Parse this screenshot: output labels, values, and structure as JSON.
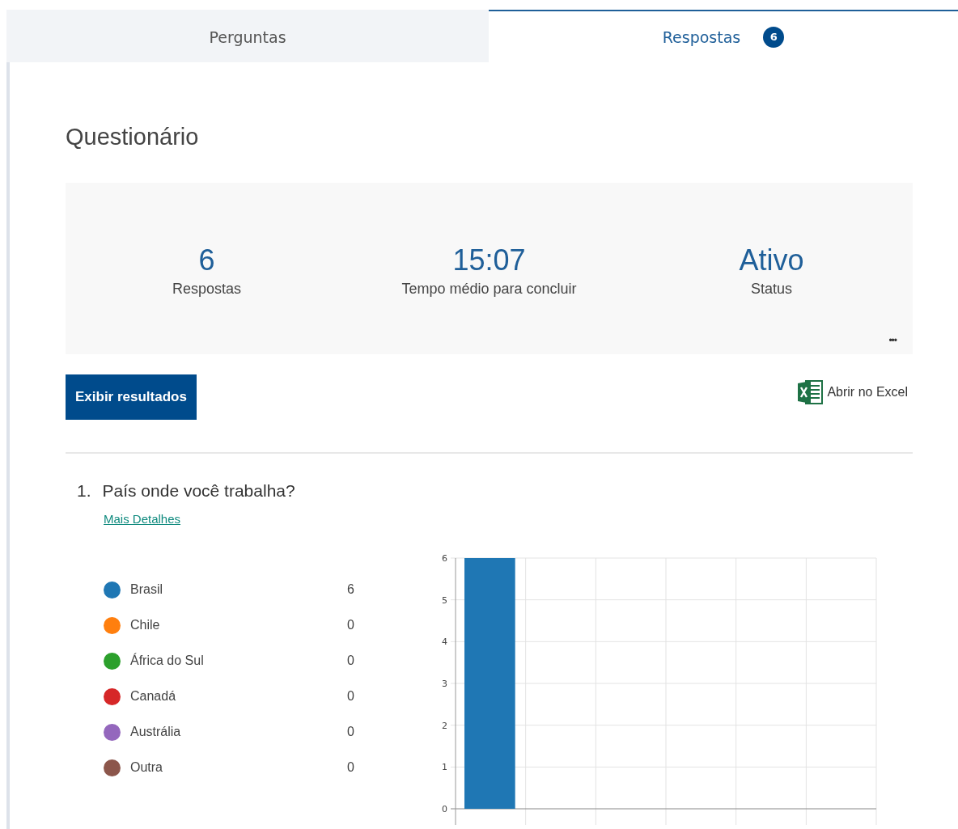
{
  "tabs": [
    {
      "label": "Perguntas",
      "selected": false
    },
    {
      "label": "Respostas",
      "selected": true,
      "badge": "6"
    }
  ],
  "title": "Questionário",
  "stats": [
    {
      "value": "6",
      "label": "Respostas"
    },
    {
      "value": "15:07",
      "label": "Tempo médio para concluir"
    },
    {
      "value": "Ativo",
      "label": "Status"
    }
  ],
  "more_button": "•••",
  "view_results_button": "Exibir resultados",
  "excel_link": "Abrir no Excel",
  "question": {
    "number": "1.",
    "text": "País onde você trabalha?",
    "details_link": "Mais Detalhes",
    "options": [
      {
        "label": "Brasil",
        "count": "6",
        "color": "#1f77b4"
      },
      {
        "label": "Chile",
        "count": "0",
        "color": "#ff7f0e"
      },
      {
        "label": "África do Sul",
        "count": "0",
        "color": "#2ca02c"
      },
      {
        "label": "Canadá",
        "count": "0",
        "color": "#d62728"
      },
      {
        "label": "Austrália",
        "count": "0",
        "color": "#9467bd"
      },
      {
        "label": "Outra",
        "count": "0",
        "color": "#8c564b"
      }
    ],
    "chart_data": {
      "type": "bar",
      "grid": true,
      "values": [
        6,
        0,
        0,
        0,
        0,
        0
      ],
      "ylim": [
        0,
        6
      ],
      "yticks": [
        0,
        1,
        2,
        3,
        4,
        5,
        6
      ]
    }
  }
}
